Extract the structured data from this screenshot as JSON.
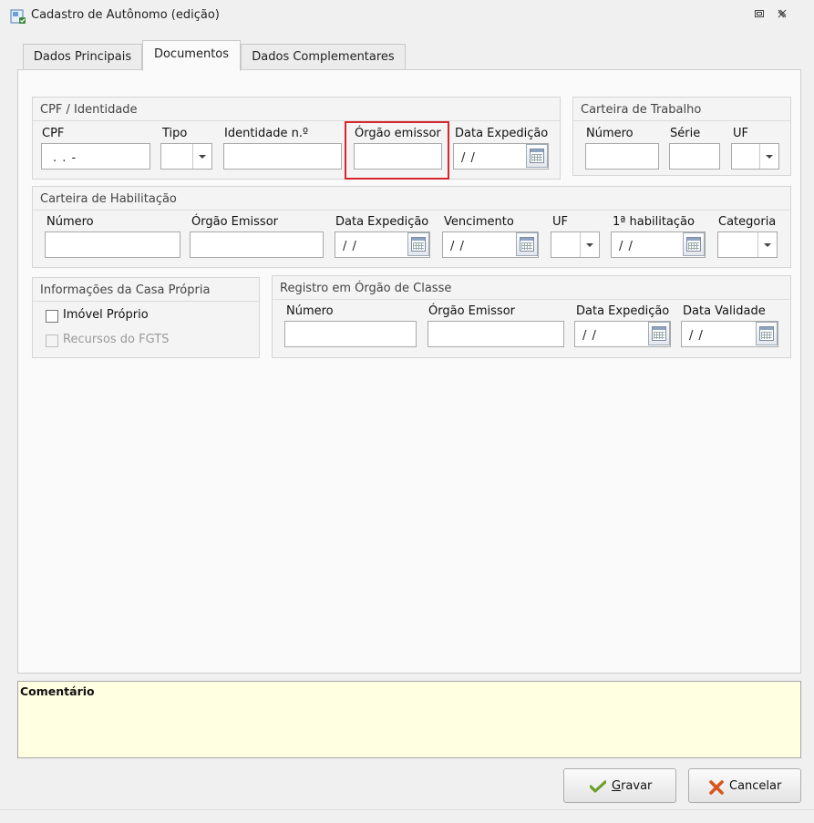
{
  "window": {
    "title": "Cadastro de Autônomo (edição)",
    "icons": [
      "app-icon",
      "restore-icon",
      "close-icon"
    ]
  },
  "tabs": [
    {
      "label": "Dados Principais",
      "active": false
    },
    {
      "label": "Documentos",
      "active": true
    },
    {
      "label": "Dados Complementares",
      "active": false
    }
  ],
  "cpf_group": {
    "title": "CPF / Identidade",
    "cpf_label": "CPF",
    "cpf_value": ". . -",
    "tipo_label": "Tipo",
    "tipo_value": "",
    "identidade_label": "Identidade n.º",
    "identidade_value": "",
    "orgao_label": "Órgão emissor",
    "orgao_value": "",
    "data_label": "Data Expedição",
    "data_value": "/ /"
  },
  "carteira_trabalho": {
    "title": "Carteira de Trabalho",
    "numero_label": "Número",
    "numero_value": "",
    "serie_label": "Série",
    "serie_value": "",
    "uf_label": "UF",
    "uf_value": ""
  },
  "habilitacao": {
    "title": "Carteira de Habilitação",
    "numero_label": "Número",
    "orgao_label": "Órgão Emissor",
    "data_exp_label": "Data Expedição",
    "data_exp_value": "/ /",
    "vencimento_label": "Vencimento",
    "vencimento_value": "/ /",
    "uf_label": "UF",
    "primeira_label": "1ª habilitação",
    "primeira_value": "/ /",
    "categoria_label": "Categoria"
  },
  "casa_propria": {
    "title": "Informações da Casa Própria",
    "imovel_label": "Imóvel Próprio",
    "imovel_checked": false,
    "fgts_label": "Recursos do FGTS",
    "fgts_checked": false,
    "fgts_enabled": false
  },
  "registro_classe": {
    "title": "Registro em Órgão de Classe",
    "numero_label": "Número",
    "orgao_label": "Órgão Emissor",
    "data_exp_label": "Data Expedição",
    "data_exp_value": "/ /",
    "data_val_label": "Data Validade",
    "data_val_value": "/ /"
  },
  "comment": {
    "label": "Comentário",
    "value": ""
  },
  "buttons": {
    "save_label": "Gravar",
    "cancel_label": "Cancelar"
  },
  "colors": {
    "highlight": "#d4262d",
    "comment_bg": "#ffffe1",
    "save_icon": "#6a9f2a",
    "cancel_icon": "#d9541e"
  }
}
